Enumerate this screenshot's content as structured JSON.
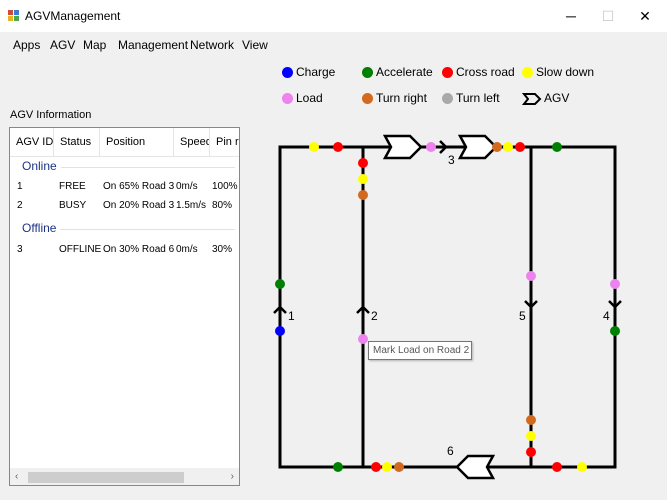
{
  "window": {
    "title": "AGVManagement",
    "minimize": "─",
    "maximize": "☐",
    "close": "✕"
  },
  "menu": [
    "Apps",
    "AGV",
    "Map",
    "Management",
    "Network",
    "View"
  ],
  "agv_panel": {
    "title": "AGV Information",
    "columns": [
      "AGV ID",
      "Status",
      "Position",
      "Speed",
      "Pin rem"
    ],
    "groups": [
      {
        "name": "Online",
        "rows": [
          {
            "id": "1",
            "status": "FREE",
            "position": "On 65% Road 3",
            "speed": "0m/s",
            "pin": "100%"
          },
          {
            "id": "2",
            "status": "BUSY",
            "position": "On 20% Road 3",
            "speed": "1.5m/s",
            "pin": "80%"
          }
        ]
      },
      {
        "name": "Offline",
        "rows": [
          {
            "id": "3",
            "status": "OFFLINE",
            "position": "On 30% Road 6",
            "speed": "0m/s",
            "pin": "30%"
          }
        ]
      }
    ]
  },
  "legend": [
    {
      "label": "Charge",
      "color": "#0000ff",
      "icon": "dot"
    },
    {
      "label": "Accelerate",
      "color": "#008000",
      "icon": "dot"
    },
    {
      "label": "Cross road",
      "color": "#ff0000",
      "icon": "dot"
    },
    {
      "label": "Slow down",
      "color": "#ffff00",
      "icon": "dot"
    },
    {
      "label": "Load",
      "color": "#ee82ee",
      "icon": "dot"
    },
    {
      "label": "Turn right",
      "color": "#d2691e",
      "icon": "dot"
    },
    {
      "label": "Turn left",
      "color": "#a9a9a9",
      "icon": "dot"
    },
    {
      "label": "AGV",
      "color": "#000000",
      "icon": "agv-shape-icon"
    }
  ],
  "map": {
    "road_labels": [
      "1",
      "2",
      "3",
      "4",
      "5",
      "6"
    ],
    "tooltip": "Mark Load on Road 2"
  }
}
